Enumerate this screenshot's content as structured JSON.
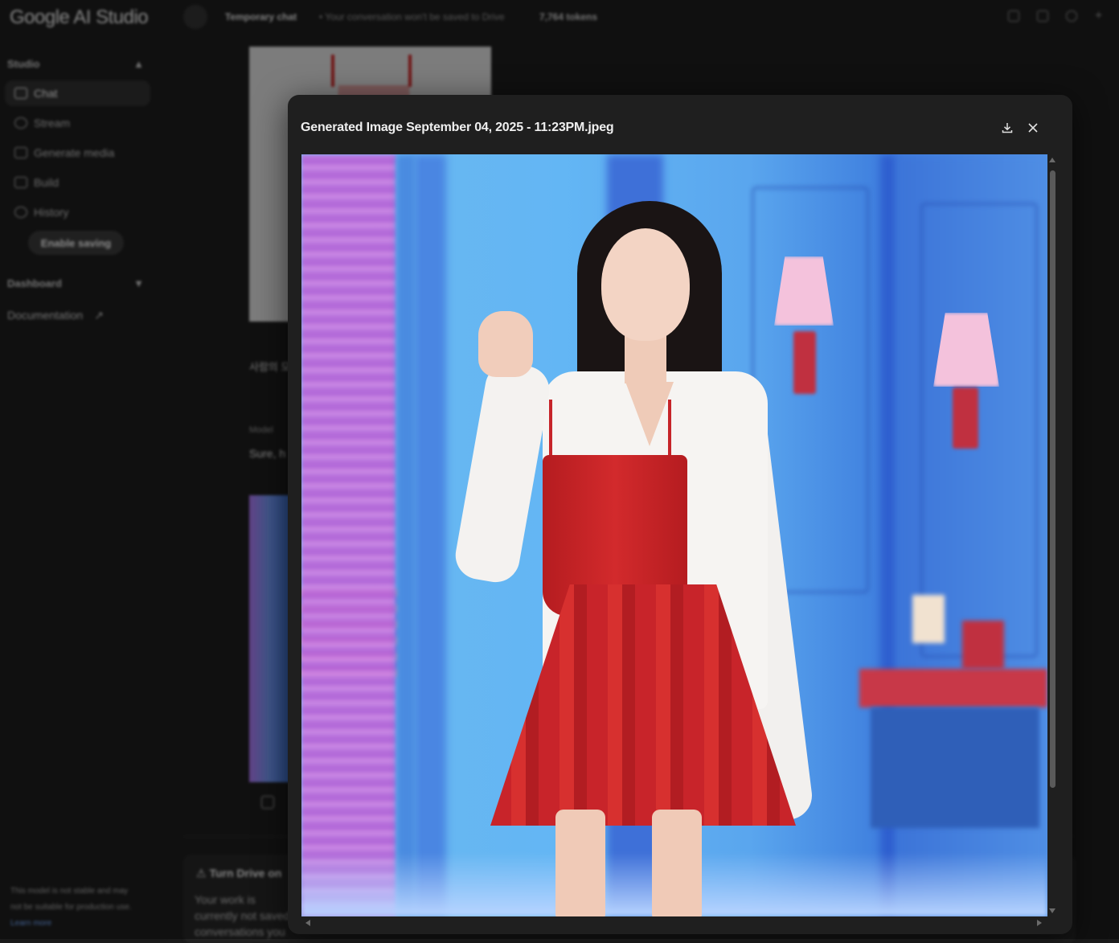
{
  "app": {
    "logo": "Google AI Studio",
    "topbar": {
      "temporary_chat": "Temporary chat",
      "temporary_note": "• Your conversation won't be saved to Drive",
      "tokens": "7,764 tokens"
    },
    "sidebar": {
      "studio_label": "Studio",
      "items": [
        {
          "label": "Chat",
          "icon": "chat-icon",
          "active": true
        },
        {
          "label": "Stream",
          "icon": "stream-icon"
        },
        {
          "label": "Generate media",
          "icon": "media-icon"
        },
        {
          "label": "Build",
          "icon": "build-icon"
        },
        {
          "label": "History",
          "icon": "history-icon"
        }
      ],
      "enable_saving": "Enable saving",
      "dashboard_label": "Dashboard",
      "documentation_label": "Documentation",
      "note_text": "This model is not stable and may not be suitable for production use.",
      "note_link": "Learn more"
    },
    "chat": {
      "user_message": "사람의 모",
      "model_label": "Model",
      "model_text": "Sure, h"
    },
    "drive_banner": {
      "title": "Turn Drive on",
      "body": "Your work is currently not saved conversations you"
    }
  },
  "modal": {
    "title": "Generated Image September 04, 2025 - 11:23PM.jpeg",
    "download_icon": "download-icon",
    "close_icon": "close-icon",
    "image_subject": "generated-image"
  },
  "colors": {
    "modal_bg": "#1f1f1f",
    "page_bg": "#1b1b1b",
    "accent_link": "#6ea0f0"
  }
}
